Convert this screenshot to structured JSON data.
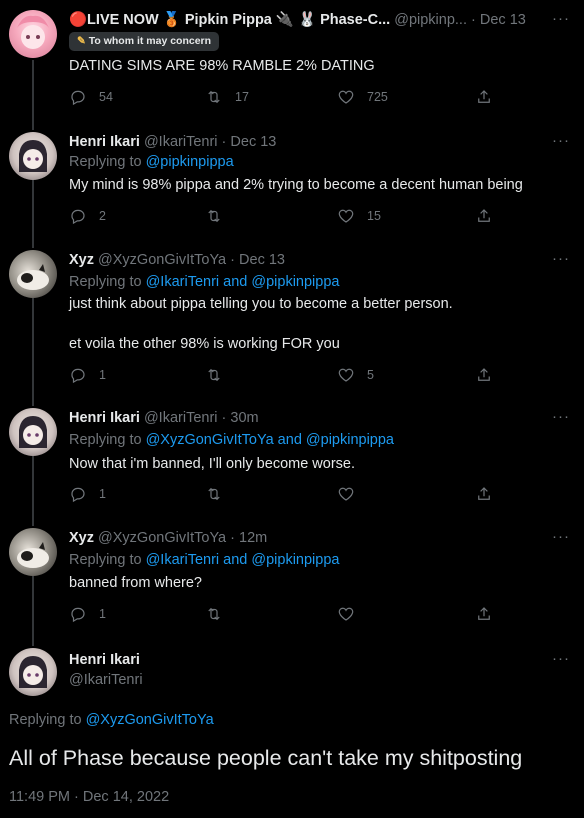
{
  "tweets": [
    {
      "name": "🔴LIVE NOW 🥉 Pipkin Pippa 🔌 🐰 Phase-C...",
      "handle": "@pipkinp...",
      "time": "Dec 13",
      "badge": "To whom it may concern",
      "text": "DATING SIMS ARE 98% RAMBLE 2% DATING",
      "replies": "54",
      "retweets": "17",
      "likes": "725"
    },
    {
      "name": "Henri Ikari",
      "handle": "@IkariTenri",
      "time": "Dec 13",
      "replying_prefix": "Replying to",
      "replying_to": "@pipkinpippa",
      "text": "My mind is 98% pippa and 2% trying to become a decent human being",
      "replies": "2",
      "retweets": "",
      "likes": "15"
    },
    {
      "name": "Xyz",
      "handle": "@XyzGonGivItToYa",
      "time": "Dec 13",
      "replying_prefix": "Replying to",
      "replying_to": "@IkariTenri and @pipkinpippa",
      "text_line1": "just think about pippa telling you to become a better person.",
      "text_line2": "et voila the other 98% is working FOR you",
      "replies": "1",
      "retweets": "",
      "likes": "5"
    },
    {
      "name": "Henri Ikari",
      "handle": "@IkariTenri",
      "time": "30m",
      "replying_prefix": "Replying to",
      "replying_to": "@XyzGonGivItToYa and @pipkinpippa",
      "text": "Now that i'm banned, I'll only become worse.",
      "replies": "1",
      "retweets": "",
      "likes": ""
    },
    {
      "name": "Xyz",
      "handle": "@XyzGonGivItToYa",
      "time": "12m",
      "replying_prefix": "Replying to",
      "replying_to": "@IkariTenri and @pipkinpippa",
      "text": "banned from where?",
      "replies": "1",
      "retweets": "",
      "likes": ""
    }
  ],
  "main_tweet": {
    "name": "Henri Ikari",
    "handle": "@IkariTenri",
    "replying_prefix": "Replying to",
    "replying_to": "@XyzGonGivItToYa",
    "text": "All of Phase because people can't take my shitposting",
    "timestamp": "11:49 PM · Dec 14, 2022"
  },
  "dot": "·",
  "more": "···",
  "icons": {
    "reply": "reply-icon",
    "retweet": "retweet-icon",
    "like": "like-icon",
    "share": "share-icon",
    "more": "more-icon",
    "pencil": "pencil-icon"
  },
  "colors": {
    "background": "#000000",
    "text": "#e7e9ea",
    "muted": "#71767b",
    "link": "#1d9bf0",
    "thread_line": "#333639"
  }
}
